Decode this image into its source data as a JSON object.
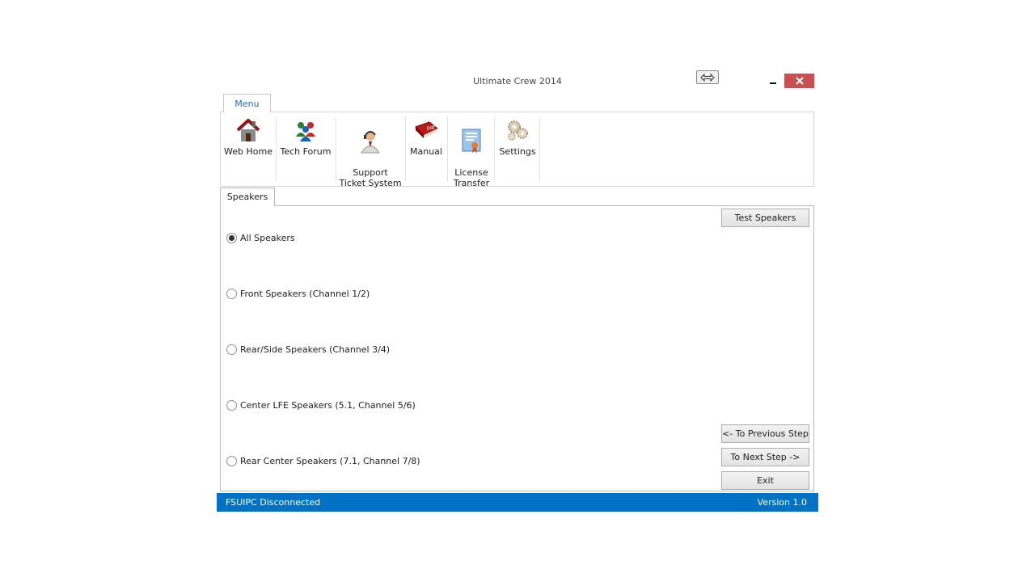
{
  "window": {
    "title": "Ultimate Crew 2014"
  },
  "ribbon": {
    "tab_label": "Menu",
    "items": [
      {
        "label": "Web Home",
        "icon": "home-icon"
      },
      {
        "label": "Tech Forum",
        "icon": "forum-people-icon"
      },
      {
        "label": "Support\nTicket System",
        "icon": "support-agent-icon"
      },
      {
        "label": "Manual",
        "icon": "pdf-book-icon"
      },
      {
        "label": "License\nTransfer",
        "icon": "certificate-icon"
      },
      {
        "label": "Settings",
        "icon": "gears-icon"
      }
    ]
  },
  "speakers_tab": {
    "label": "Speakers",
    "test_button": "Test Speakers",
    "options": [
      {
        "label": "All Speakers",
        "checked": true
      },
      {
        "label": "Front Speakers (Channel 1/2)",
        "checked": false
      },
      {
        "label": "Rear/Side Speakers (Channel 3/4)",
        "checked": false
      },
      {
        "label": "Center LFE Speakers (5.1, Channel 5/6)",
        "checked": false
      },
      {
        "label": "Rear Center Speakers (7.1, Channel 7/8)",
        "checked": false
      }
    ],
    "prev_button": "<- To Previous Step",
    "next_button": "To Next Step ->",
    "exit_button": "Exit"
  },
  "status_bar": {
    "left_text": "FSUIPC Disconnected",
    "right_text": "Version 1.0"
  },
  "colors": {
    "status_bar": "#0072c6",
    "close_button": "#c75050",
    "ribbon_tab_text": "#2b6cb3"
  }
}
